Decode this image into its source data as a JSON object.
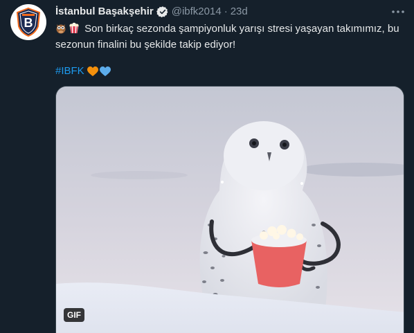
{
  "author": {
    "display_name": "İstanbul Başakşehir",
    "handle": "@ibfk2014",
    "separator": "·",
    "time": "23d",
    "avatar_icon": "basaksehir-crest-icon"
  },
  "tweet": {
    "emoji_prefix": [
      "owl-emoji",
      "popcorn-emoji"
    ],
    "text": "Son birkaç sezonda şampiyonluk yarışı stresi yaşayan takımımız, bu sezonun finalini bu şekilde takip ediyor!",
    "hashtag": "#IBFK",
    "hearts": [
      "orange-heart-icon",
      "blue-heart-icon"
    ]
  },
  "media": {
    "type": "gif",
    "badge": "GIF",
    "description_icon": "snowy-owl-with-popcorn"
  },
  "menu": {
    "more_icon": "more-dots-icon"
  },
  "colors": {
    "background": "#15202b",
    "hashtag": "#1d9bf0",
    "verified": "#e7e9ea",
    "orange_heart": "#f4900c",
    "blue_heart": "#5dadec"
  }
}
